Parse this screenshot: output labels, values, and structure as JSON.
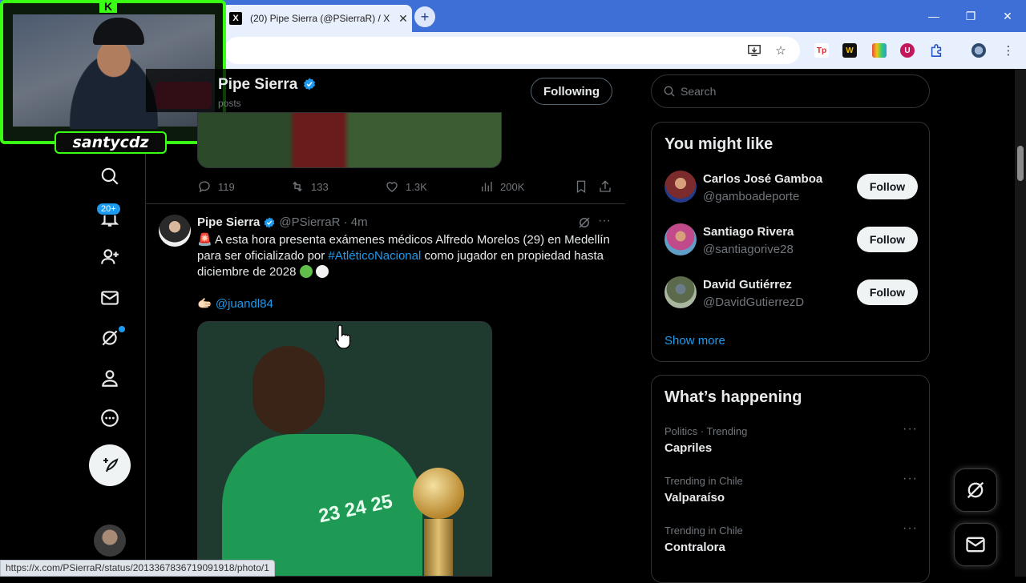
{
  "browser": {
    "tab_title": "(20) Pipe Sierra (@PSierraR) / X",
    "tab_close": "✕",
    "new_tab": "+",
    "window_controls": [
      "—",
      "❐",
      "✕"
    ],
    "status_url": "https://x.com/PSierraR/status/2013367836719091918/photo/1",
    "ext_labels": [
      "Tp",
      "W",
      "U"
    ]
  },
  "overlay": {
    "streamer_name": "santycdz",
    "logo": "K"
  },
  "nav": {
    "notifications_badge": "20+"
  },
  "profile_header": {
    "name": "Pipe Sierra",
    "sub": "posts",
    "following_label": "Following"
  },
  "prev_tweet": {
    "replies": "119",
    "retweets": "133",
    "likes": "1.3K",
    "views": "200K"
  },
  "tweet": {
    "name": "Pipe Sierra",
    "handle_time": "@PSierraR · 4m",
    "text_line_1": "A esta hora presenta exámenes médicos Alfredo Morelos (29) en Medellín para ser oficializado por ",
    "hashtag": "#AtléticoNacional",
    "text_line_2": " como jugador en propiedad hasta diciembre de 2028",
    "mention_emoji": "🫱🏻",
    "mention": "@juandl84",
    "image_shirt_text": "23 24 25"
  },
  "search": {
    "placeholder": "Search"
  },
  "who_to_follow": {
    "title": "You might like",
    "follow_label": "Follow",
    "people": [
      {
        "name": "Carlos José Gamboa",
        "handle": "@gamboadeporte",
        "color": "#7b2b2b"
      },
      {
        "name": "Santiago Rivera",
        "handle": "@santiagorive28",
        "color": "#c04a8a"
      },
      {
        "name": "David Gutiérrez",
        "handle": "@DavidGutierrezD",
        "color": "#5a6a4a"
      }
    ],
    "show_more": "Show more"
  },
  "trends": {
    "title": "What’s happening",
    "more": "···",
    "items": [
      {
        "category": "Politics · Trending",
        "name": "Capriles"
      },
      {
        "category": "Trending in Chile",
        "name": "Valparaíso"
      },
      {
        "category": "Trending in Chile",
        "name": "Contralora"
      }
    ]
  },
  "colors": {
    "accent": "#1d9bf0",
    "overlay_green": "#39ff14",
    "chrome_blue": "#3d6fd6"
  }
}
